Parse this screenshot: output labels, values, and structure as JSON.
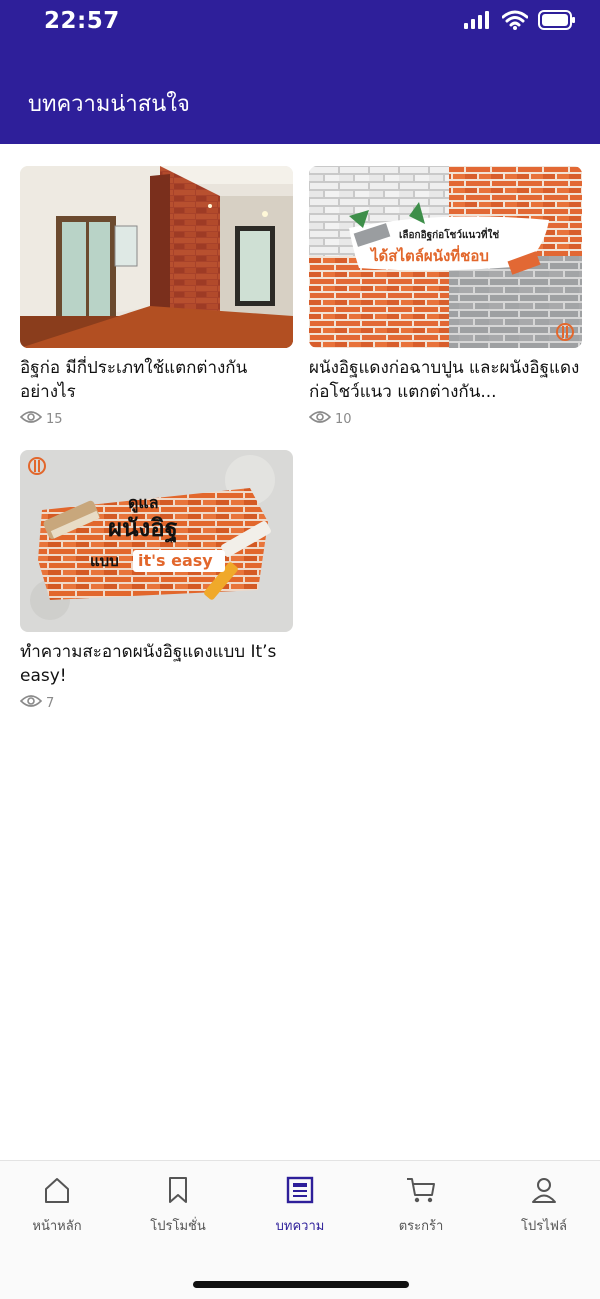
{
  "status_bar": {
    "time": "22:57"
  },
  "header": {
    "title": "บทความน่าสนใจ"
  },
  "articles": [
    {
      "title": "อิฐก่อ มีกี่ประเภทใช้แตกต่างกันอย่างไร",
      "views": "15"
    },
    {
      "title": "ผนังอิฐแดงก่อฉาบปูน และผนังอิฐแดงก่อโชว์แนว แตกต่างกัน...",
      "views": "10",
      "image_text": {
        "line1": "เลือกอิฐก่อโชว์แนวที่ใช่",
        "line2": "ได้สไตล์ผนังที่ชอบ"
      }
    },
    {
      "title": "ทำความสะอาดผนังอิฐแดงแบบ It’s easy!",
      "views": "7",
      "image_text": {
        "line1": "ดูแล",
        "line2": "ผนังอิฐ",
        "line3a": "แบบ",
        "line3b": "it's easy"
      }
    }
  ],
  "tabbar": {
    "items": [
      {
        "label": "หน้าหลัก",
        "icon": "home-icon"
      },
      {
        "label": "โปรโมชั่น",
        "icon": "bookmark-icon"
      },
      {
        "label": "บทความ",
        "icon": "article-icon",
        "active": true
      },
      {
        "label": "ตระกร้า",
        "icon": "cart-icon"
      },
      {
        "label": "โปรไฟล์",
        "icon": "profile-icon"
      }
    ]
  },
  "colors": {
    "brand": "#2e1f9a",
    "accent_orange": "#e2672c"
  }
}
